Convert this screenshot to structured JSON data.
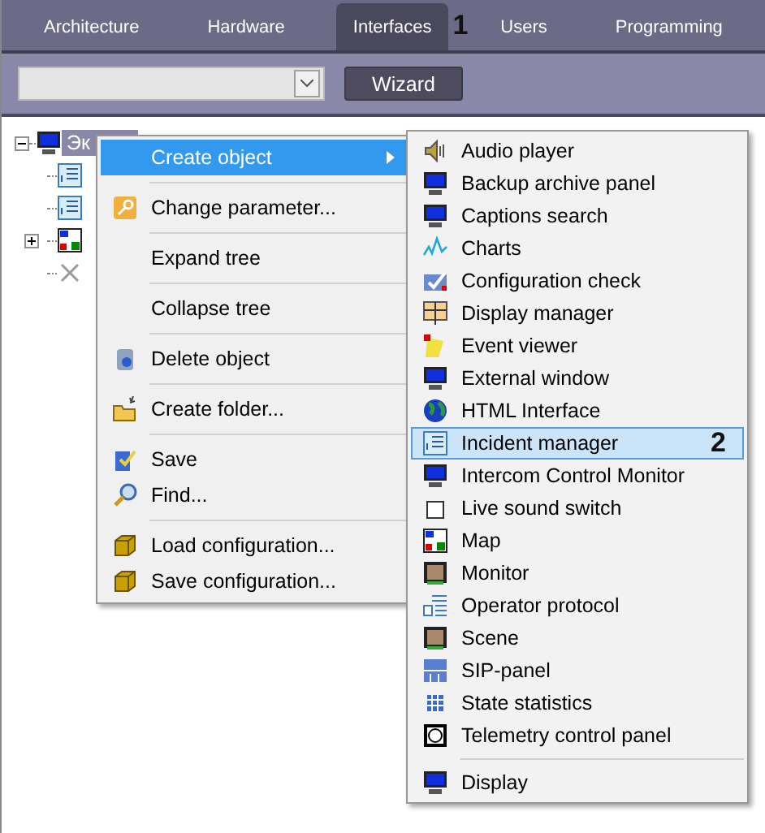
{
  "tabs": [
    {
      "label": "Architecture",
      "selected": false
    },
    {
      "label": "Hardware",
      "selected": false
    },
    {
      "label": "Interfaces",
      "selected": true,
      "marker": "1"
    },
    {
      "label": "Users",
      "selected": false
    },
    {
      "label": "Programming",
      "selected": false
    }
  ],
  "toolbar": {
    "button": "Wizard"
  },
  "tree": {
    "label": "Эк",
    "selected": true,
    "expanded": true,
    "children": [
      {
        "kind": "list"
      },
      {
        "kind": "list"
      },
      {
        "kind": "map",
        "expanded": false
      },
      {
        "kind": "deleted"
      }
    ]
  },
  "context_menu": {
    "groups": [
      [
        {
          "label": "Create object",
          "selected": true,
          "submenu": true
        }
      ],
      [
        {
          "label": "Change parameter...",
          "selected": false
        }
      ],
      [
        {
          "label": "Expand tree",
          "selected": false
        }
      ],
      [
        {
          "label": "Collapse tree",
          "selected": false
        }
      ],
      [
        {
          "label": "Delete object",
          "selected": false
        }
      ],
      [
        {
          "label": "Create folder...",
          "selected": false
        }
      ],
      [
        {
          "label": "Save",
          "selected": false
        },
        {
          "label": "Find...",
          "selected": false
        }
      ],
      [
        {
          "label": "Load configuration...",
          "selected": false
        },
        {
          "label": "Save configuration...",
          "selected": false
        }
      ]
    ]
  },
  "submenu": {
    "groups": [
      [
        {
          "label": "Audio player",
          "selected": false
        },
        {
          "label": "Backup archive panel",
          "selected": false
        },
        {
          "label": "Captions search",
          "selected": false
        },
        {
          "label": "Charts",
          "selected": false
        },
        {
          "label": "Configuration check",
          "selected": false
        },
        {
          "label": "Display manager",
          "selected": false
        },
        {
          "label": "Event viewer",
          "selected": false
        },
        {
          "label": "External window",
          "selected": false
        },
        {
          "label": "HTML Interface",
          "selected": false
        },
        {
          "label": "Incident manager",
          "selected": true,
          "marker": "2"
        },
        {
          "label": "Intercom Control Monitor",
          "selected": false
        },
        {
          "label": "Live sound switch",
          "selected": false
        },
        {
          "label": "Map",
          "selected": false
        },
        {
          "label": "Monitor",
          "selected": false
        },
        {
          "label": "Operator protocol",
          "selected": false
        },
        {
          "label": "Scene",
          "selected": false
        },
        {
          "label": "SIP-panel",
          "selected": false
        },
        {
          "label": "State statistics",
          "selected": false
        },
        {
          "label": "Telemetry control panel",
          "selected": false
        }
      ],
      [
        {
          "label": "Display",
          "selected": false
        }
      ]
    ]
  }
}
